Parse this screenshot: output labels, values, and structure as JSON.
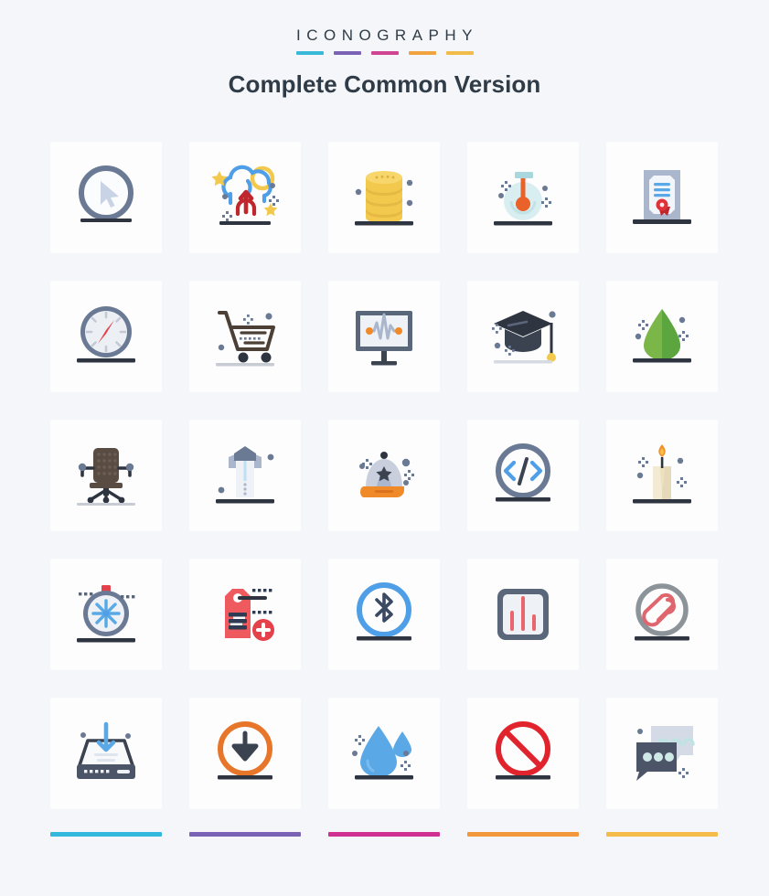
{
  "header": {
    "kicker": "ICONOGRAPHY",
    "title": "Complete Common Version",
    "kicker_rule_colors": [
      "#39b9d8",
      "#7a62b5",
      "#cf4591",
      "#f0a33f",
      "#f2bc4a"
    ]
  },
  "footer": {
    "rule_colors": [
      "#32b8dd",
      "#7a62b5",
      "#cf3092",
      "#f2973a",
      "#f5bb49"
    ]
  },
  "palette": {
    "background": "#f4f6f9",
    "card_background": "#fdfdfe",
    "text": "#2f3b46",
    "ground_bar": "#3b4250",
    "slate": "#6b7a94",
    "light_slate": "#aab6cc",
    "gold": "#f2c94c",
    "gold_dark": "#e0b03c",
    "blue": "#4f9ee8",
    "red": "#e5414a",
    "green": "#5ca63f",
    "orange": "#e8762a",
    "dark": "#434a59"
  },
  "grid": {
    "columns": 5,
    "rows": 5,
    "total_icons": 25,
    "icons": [
      {
        "index": 1,
        "name": "cursor-in-circle-icon",
        "label": "Click Cursor"
      },
      {
        "index": 2,
        "name": "cloud-upload-icon",
        "label": "Cloud Upload"
      },
      {
        "index": 3,
        "name": "coin-stack-icon",
        "label": "Coins"
      },
      {
        "index": 4,
        "name": "flask-thermometer-icon",
        "label": "Temperature Flask"
      },
      {
        "index": 5,
        "name": "certificate-icon",
        "label": "Certificate"
      },
      {
        "index": 6,
        "name": "compass-icon",
        "label": "Compass"
      },
      {
        "index": 7,
        "name": "shopping-cart-icon",
        "label": "Shopping Cart"
      },
      {
        "index": 8,
        "name": "monitor-pulse-icon",
        "label": "Monitor Waveform"
      },
      {
        "index": 9,
        "name": "graduation-cap-icon",
        "label": "Graduation Cap"
      },
      {
        "index": 10,
        "name": "leaf-icon",
        "label": "Leaf"
      },
      {
        "index": 11,
        "name": "office-chair-icon",
        "label": "Office Chair"
      },
      {
        "index": 12,
        "name": "shirt-icon",
        "label": "Shirt"
      },
      {
        "index": 13,
        "name": "baseball-cap-icon",
        "label": "Cap"
      },
      {
        "index": 14,
        "name": "code-brackets-icon",
        "label": "Code"
      },
      {
        "index": 15,
        "name": "candle-icon",
        "label": "Candle"
      },
      {
        "index": 16,
        "name": "stopwatch-snowflake-icon",
        "label": "Timer"
      },
      {
        "index": 17,
        "name": "price-tag-add-icon",
        "label": "Add Tag"
      },
      {
        "index": 18,
        "name": "bluetooth-icon",
        "label": "Bluetooth"
      },
      {
        "index": 19,
        "name": "equalizer-icon",
        "label": "Equalizer"
      },
      {
        "index": 20,
        "name": "paperclip-icon",
        "label": "Attachment"
      },
      {
        "index": 21,
        "name": "inbox-download-icon",
        "label": "Inbox"
      },
      {
        "index": 22,
        "name": "download-circle-icon",
        "label": "Download"
      },
      {
        "index": 23,
        "name": "water-drop-icon",
        "label": "Water Drop"
      },
      {
        "index": 24,
        "name": "prohibited-icon",
        "label": "Forbidden"
      },
      {
        "index": 25,
        "name": "chat-bubbles-icon",
        "label": "Chat"
      }
    ]
  }
}
